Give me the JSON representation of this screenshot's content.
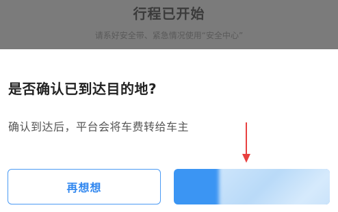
{
  "background": {
    "title": "行程已开始",
    "subtitle": "请系好安全带、紧急情况使用“安全中心”"
  },
  "dialog": {
    "title": "是否确认已到达目的地?",
    "message": "确认到达后，平台会将车费转给车主",
    "secondary_button": "再想想",
    "primary_button": ""
  },
  "colors": {
    "accent": "#3b95f3",
    "annotation": "#e8403f"
  },
  "icons": {
    "annotation": "red-arrow-down-icon"
  }
}
